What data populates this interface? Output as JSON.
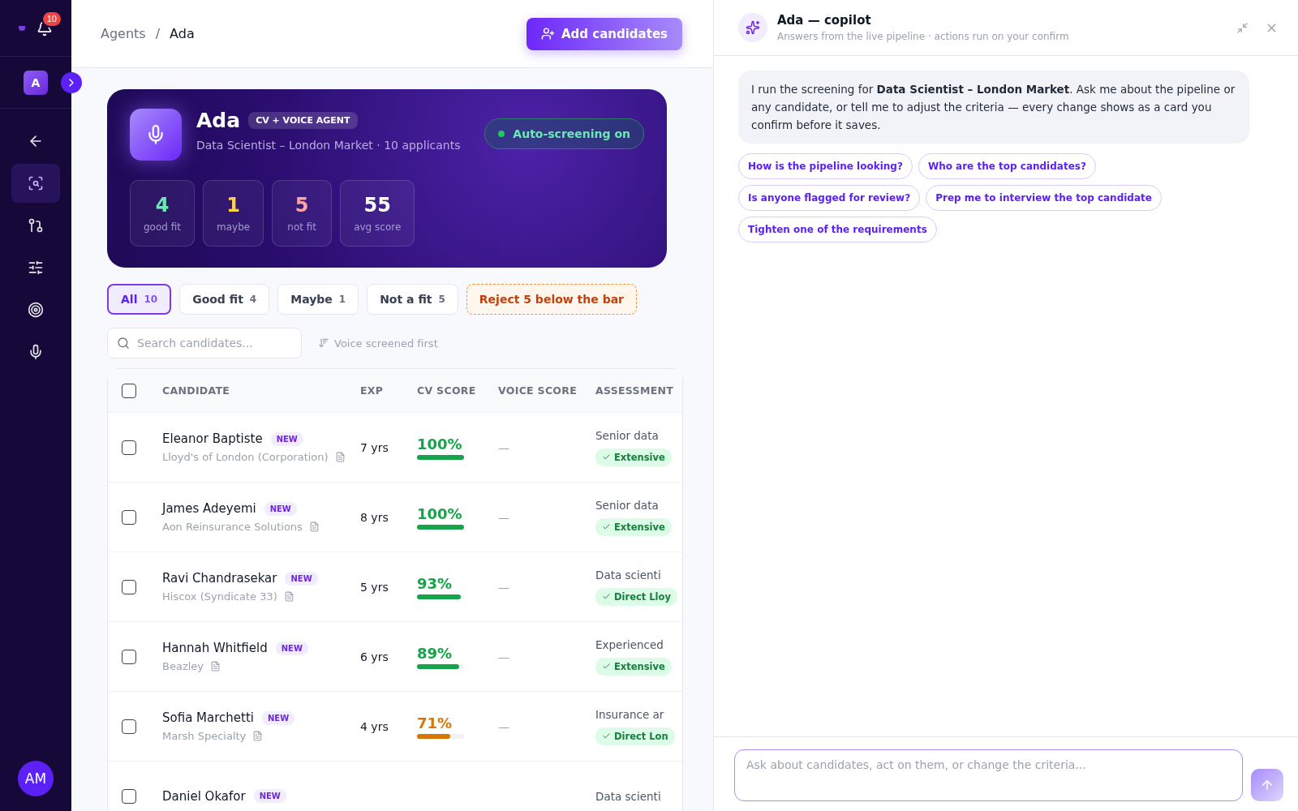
{
  "sidebar": {
    "notifications": "10",
    "workspace": "A",
    "nav": [
      {
        "kind": "back",
        "selected": false
      },
      {
        "kind": "screen",
        "selected": true
      },
      {
        "kind": "flow",
        "selected": false
      },
      {
        "kind": "sliders",
        "selected": false
      },
      {
        "kind": "target",
        "selected": false
      },
      {
        "kind": "mic",
        "selected": false
      }
    ],
    "user": "AM"
  },
  "breadcrumb": {
    "items": [
      "Agents",
      "Ada"
    ],
    "separator": "/"
  },
  "add_button": "Add candidates",
  "agent": {
    "name": "Ada",
    "badge": "CV + VOICE AGENT",
    "subtitle": "Data Scientist – London Market · 10 applicants",
    "status": {
      "label": "Auto-screening on",
      "on": true
    },
    "stats": [
      {
        "value": "4",
        "label": "good fit",
        "color": "#6ee7b7"
      },
      {
        "value": "1",
        "label": "maybe",
        "color": "#fcd34d"
      },
      {
        "value": "5",
        "label": "not fit",
        "color": "#fca5a5"
      },
      {
        "value": "55",
        "label": "avg score",
        "color": "#ffffff"
      }
    ]
  },
  "filters": [
    {
      "label": "All",
      "count": "10",
      "selected": true
    },
    {
      "label": "Good fit",
      "count": "4",
      "selected": false
    },
    {
      "label": "Maybe",
      "count": "1",
      "selected": false
    },
    {
      "label": "Not a fit",
      "count": "5",
      "selected": false
    }
  ],
  "reject_button": "Reject 5 below the bar",
  "search": {
    "placeholder": "Search candidates..."
  },
  "sort": "Voice screened first",
  "table": {
    "all_checked": false,
    "columns": [
      "CANDIDATE",
      "EXP",
      "CV SCORE",
      "VOICE SCORE",
      "ASSESSMENT"
    ],
    "rows": [
      {
        "name": "Eleanor Baptiste",
        "badge": "NEW",
        "company": "Lloyd's of London (Corporation)",
        "exp": "7 yrs",
        "score": "100%",
        "level": 1,
        "color": "#16a34a",
        "voice": "—",
        "summary": "Senior data",
        "tag": "Extensive",
        "checked": false
      },
      {
        "name": "James Adeyemi",
        "badge": "NEW",
        "company": "Aon Reinsurance Solutions",
        "exp": "8 yrs",
        "score": "100%",
        "level": 1,
        "color": "#16a34a",
        "voice": "—",
        "summary": "Senior data",
        "tag": "Extensive",
        "checked": false
      },
      {
        "name": "Ravi Chandrasekar",
        "badge": "NEW",
        "company": "Hiscox (Syndicate 33)",
        "exp": "5 yrs",
        "score": "93%",
        "level": 0.93,
        "color": "#16a34a",
        "voice": "—",
        "summary": "Data scienti",
        "tag": "Direct Lloy",
        "checked": false
      },
      {
        "name": "Hannah Whitfield",
        "badge": "NEW",
        "company": "Beazley",
        "exp": "6 yrs",
        "score": "89%",
        "level": 0.89,
        "color": "#16a34a",
        "voice": "—",
        "summary": "Experienced",
        "tag": "Extensive",
        "checked": false
      },
      {
        "name": "Sofia Marchetti",
        "badge": "NEW",
        "company": "Marsh Specialty",
        "exp": "4 yrs",
        "score": "71%",
        "level": 0.71,
        "color": "#d97706",
        "voice": "—",
        "summary": "Insurance ar",
        "tag": "Direct Lon",
        "checked": false
      },
      {
        "name": "Daniel Okafor",
        "badge": "NEW",
        "summary": "Data scienti",
        "checked": false
      }
    ]
  },
  "copilot": {
    "title": "Ada — copilot",
    "subtitle": "Answers from the live pipeline · actions run on your confirm",
    "message": "I run the screening for **Data Scientist – London Market**. Ask me about the pipeline or any candidate, or tell me to adjust the criteria — every change shows as a card you confirm before it saves.",
    "suggestions": [
      "How is the pipeline looking?",
      "Who are the top candidates?",
      "Is anyone flagged for review?",
      "Prep me to interview the top candidate",
      "Tighten one of the requirements"
    ],
    "input": {
      "placeholder": "Ask about candidates, act on them, or change the criteria..."
    }
  }
}
